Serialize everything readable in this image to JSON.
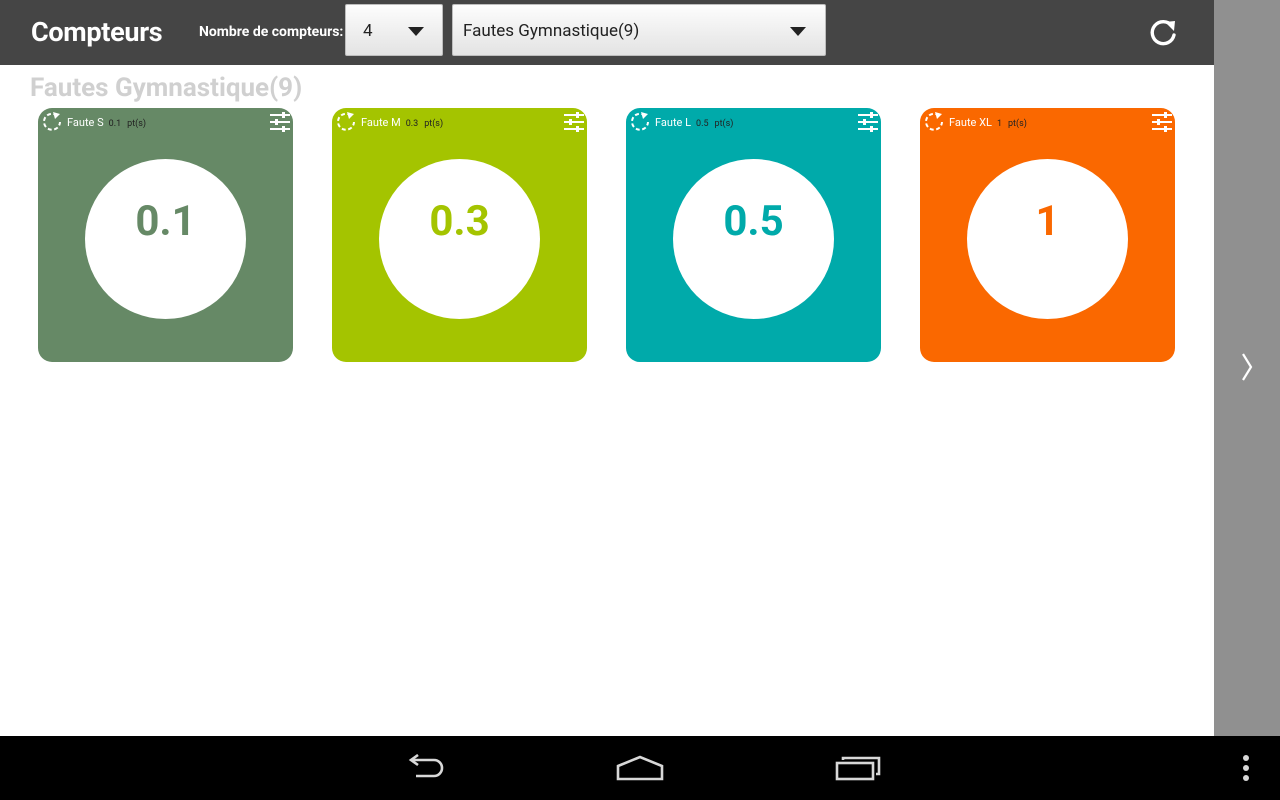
{
  "app": {
    "title": "Compteurs"
  },
  "toolbar": {
    "count_label": "Nombre de compteurs:",
    "count_value": "4",
    "group_value": "Fautes Gymnastique(9)",
    "refresh_icon": "refresh-icon"
  },
  "group_title": "Fautes Gymnastique(9)",
  "colors": {
    "s": "#668966",
    "m": "#a4c400",
    "l": "#00aaaa",
    "xl": "#fa6800",
    "actionbar": "#454545"
  },
  "counters": [
    {
      "name": "Faute S",
      "points": "0.1",
      "unit": "pt(s)",
      "value": "0.1"
    },
    {
      "name": "Faute M",
      "points": "0.3",
      "unit": "pt(s)",
      "value": "0.3"
    },
    {
      "name": "Faute L",
      "points": "0.5",
      "unit": "pt(s)",
      "value": "0.5"
    },
    {
      "name": "Faute XL",
      "points": "1",
      "unit": "pt(s)",
      "value": "1"
    }
  ],
  "icons": {
    "reset": "reset-icon",
    "settings": "settings-sliders-icon",
    "next_page": "chevron-right-icon",
    "back": "back-icon",
    "home": "home-icon",
    "recents": "recents-icon",
    "menu": "overflow-menu-icon"
  }
}
